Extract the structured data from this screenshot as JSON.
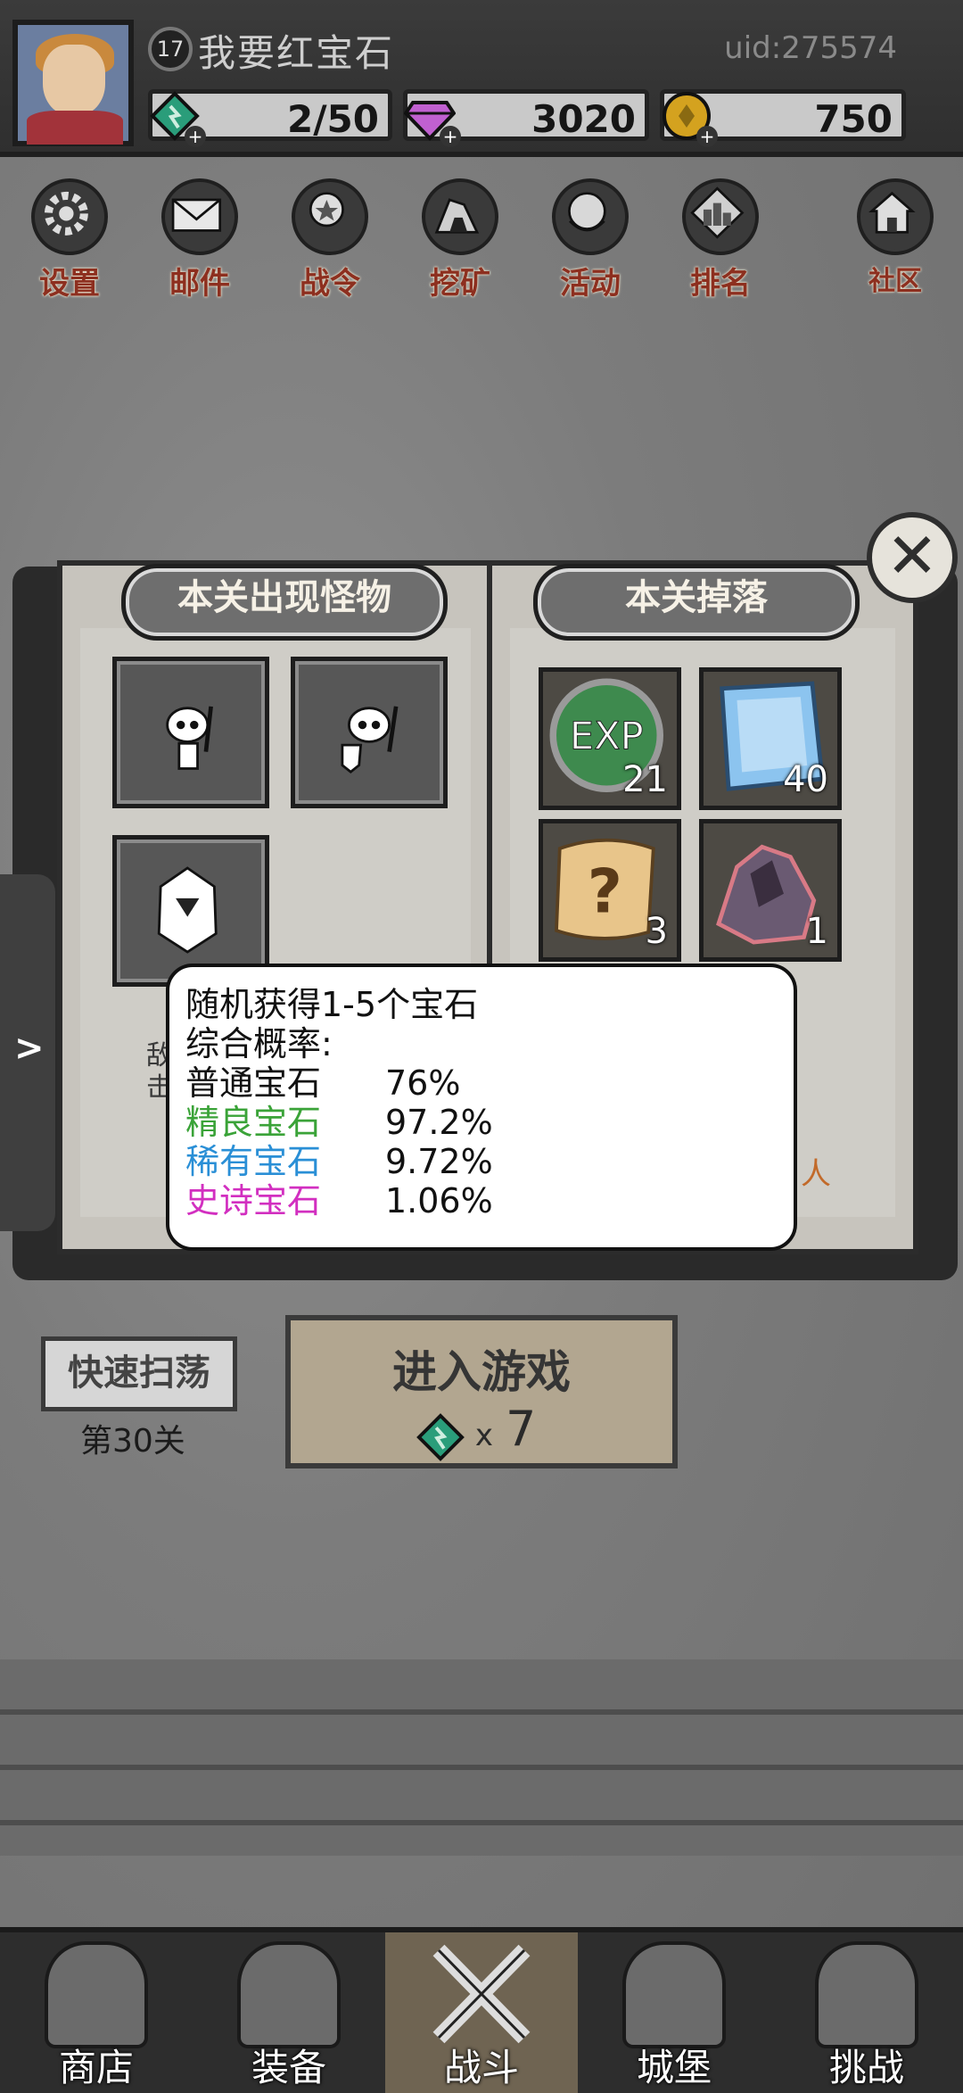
{
  "header": {
    "level": "17",
    "player_name": "我要红宝石",
    "uid": "uid:275574",
    "resources": [
      {
        "name": "stamina",
        "value": "2/50",
        "color": "#2a9d7a"
      },
      {
        "name": "gems",
        "value": "3020",
        "color": "#c060d0"
      },
      {
        "name": "coins",
        "value": "750",
        "color": "#d4a21f"
      }
    ]
  },
  "menu": [
    {
      "label": "设置",
      "icon": "gear-icon"
    },
    {
      "label": "邮件",
      "icon": "mail-icon"
    },
    {
      "label": "战令",
      "icon": "battle-pass-icon"
    },
    {
      "label": "挖矿",
      "icon": "mining-icon"
    },
    {
      "label": "活动",
      "icon": "event-icon"
    },
    {
      "label": "排名",
      "icon": "ranking-icon"
    },
    {
      "label": "社区",
      "icon": "community-icon"
    }
  ],
  "book": {
    "left_title": "本关出现怪物",
    "right_title": "本关掉落",
    "monsters": [
      "skeleton-sword",
      "skeleton-shield",
      "crystal-golem"
    ],
    "drops": [
      {
        "item": "EXP",
        "count": "21",
        "color": "#3e8a4e"
      },
      {
        "item": "ice-gem",
        "count": "40",
        "color": "#8cc4ef"
      },
      {
        "item": "scroll",
        "count": "3",
        "color": "#e8c58a"
      },
      {
        "item": "ore",
        "count": "1",
        "color": "#6a5a72"
      }
    ],
    "faded_left": "敌\n击",
    "faded_right": "人"
  },
  "tooltip": {
    "line1": "随机获得1-5个宝石",
    "line2": "综合概率:",
    "rates": [
      {
        "name": "普通宝石",
        "value": "76%",
        "color": "#111111"
      },
      {
        "name": "精良宝石",
        "value": "97.2%",
        "color": "#3aa338"
      },
      {
        "name": "稀有宝石",
        "value": "9.72%",
        "color": "#2a8fd6"
      },
      {
        "name": "史诗宝石",
        "value": "1.06%",
        "color": "#d22fc0"
      }
    ]
  },
  "side_tab": ">",
  "actions": {
    "sweep_label": "快速扫荡",
    "stage_label": "第30关",
    "enter_label": "进入游戏",
    "cost_x": "x",
    "cost_value": "7"
  },
  "close_label": "✕",
  "nav": [
    {
      "label": "商店",
      "icon": "shop-icon"
    },
    {
      "label": "装备",
      "icon": "equipment-icon"
    },
    {
      "label": "战斗",
      "icon": "battle-icon",
      "active": true
    },
    {
      "label": "城堡",
      "icon": "castle-icon"
    },
    {
      "label": "挑战",
      "icon": "challenge-icon"
    }
  ]
}
